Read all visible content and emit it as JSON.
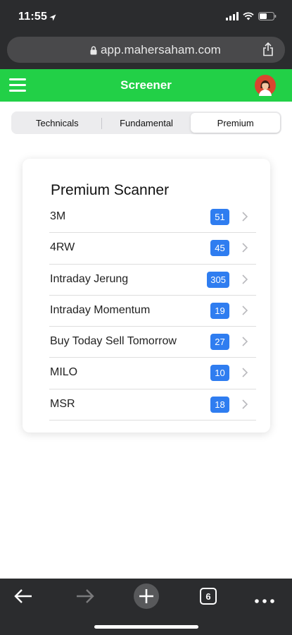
{
  "status": {
    "time": "11:55"
  },
  "browser": {
    "url": "app.mahersaham.com",
    "tab_count": "6"
  },
  "header": {
    "title": "Screener"
  },
  "tabs": [
    {
      "label": "Technicals",
      "active": false
    },
    {
      "label": "Fundamental",
      "active": false
    },
    {
      "label": "Premium",
      "active": true
    }
  ],
  "card": {
    "title": "Premium Scanner",
    "items": [
      {
        "name": "3M",
        "count": "51"
      },
      {
        "name": "4RW",
        "count": "45"
      },
      {
        "name": "Intraday Jerung",
        "count": "305"
      },
      {
        "name": "Intraday Momentum",
        "count": "19"
      },
      {
        "name": "Buy Today Sell Tomorrow",
        "count": "27"
      },
      {
        "name": "MILO",
        "count": "10"
      },
      {
        "name": "MSR",
        "count": "18"
      }
    ]
  },
  "colors": {
    "header_green": "#22d047",
    "badge_blue": "#2f7df0",
    "chrome_dark": "#2b2c2e"
  },
  "icons": {
    "status": [
      "location-arrow-icon",
      "signal-icon",
      "wifi-icon",
      "battery-icon"
    ],
    "toolbar": [
      "back-icon",
      "forward-icon",
      "new-tab-icon",
      "tabs-icon",
      "more-icon"
    ]
  }
}
